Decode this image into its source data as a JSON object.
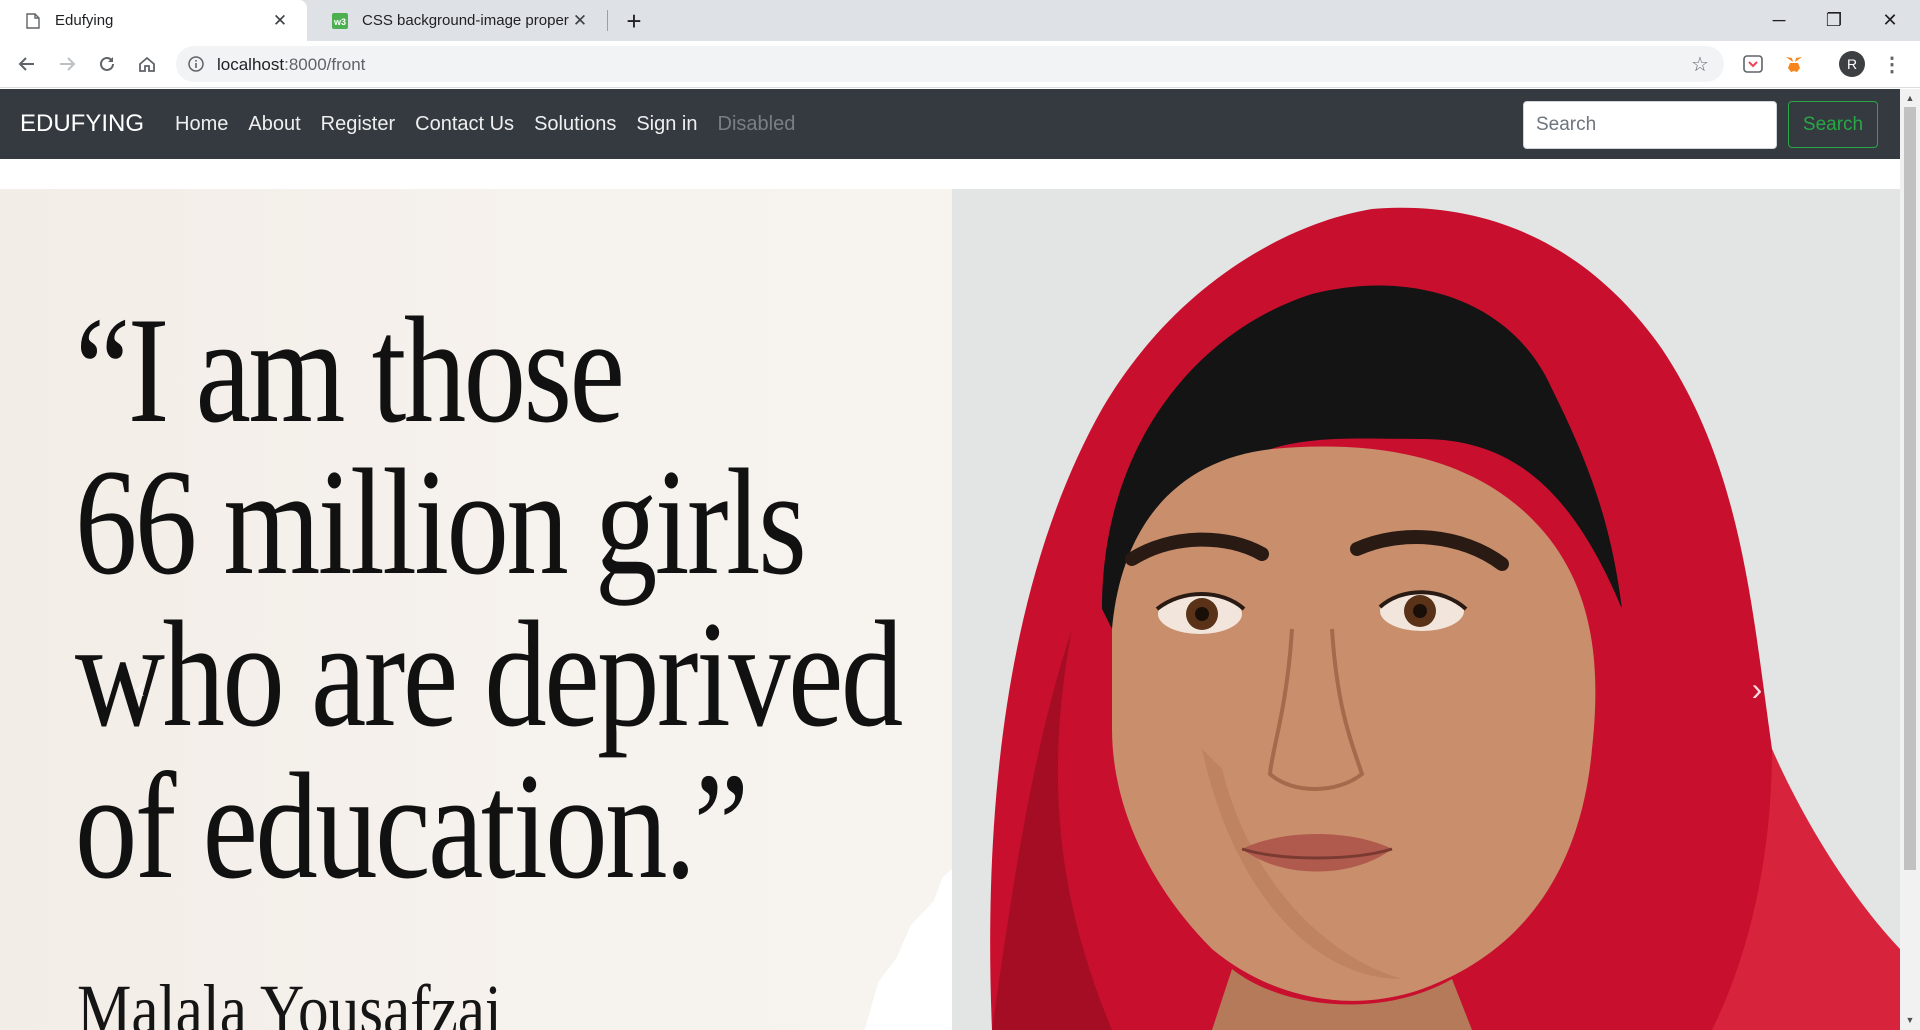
{
  "browser": {
    "tabs": [
      {
        "title": "Edufying",
        "favicon": "page-icon",
        "active": true
      },
      {
        "title": "CSS background-image property",
        "favicon": "w3schools-icon",
        "active": false
      }
    ],
    "new_tab_label": "+",
    "window_controls": {
      "minimize": "─",
      "restore": "❐",
      "close": "✕"
    },
    "url_host": "localhost",
    "url_rest": ":8000/front",
    "profile_initial": "R",
    "icons": [
      "back-icon",
      "forward-icon",
      "reload-icon",
      "home-icon",
      "info-icon",
      "star-icon",
      "pocket-icon",
      "metamask-icon",
      "menu-icon"
    ]
  },
  "navbar": {
    "brand": "EDUFYING",
    "links": [
      {
        "label": "Home",
        "disabled": false
      },
      {
        "label": "About",
        "disabled": false
      },
      {
        "label": "Register",
        "disabled": false
      },
      {
        "label": "Contact Us",
        "disabled": false
      },
      {
        "label": "Solutions",
        "disabled": false
      },
      {
        "label": "Sign in",
        "disabled": false
      },
      {
        "label": "Disabled",
        "disabled": true
      }
    ],
    "search_placeholder": "Search",
    "search_button": "Search",
    "background_color": "#343a40",
    "search_button_color": "#28a745"
  },
  "carousel": {
    "quote_lines": [
      "“I am those",
      "66 million girls",
      "who are deprived",
      "of education.”"
    ],
    "author": "Malala Yousafzai",
    "prev_icon": "‹",
    "next_icon": "›",
    "scarf_color": "#c8102e"
  }
}
